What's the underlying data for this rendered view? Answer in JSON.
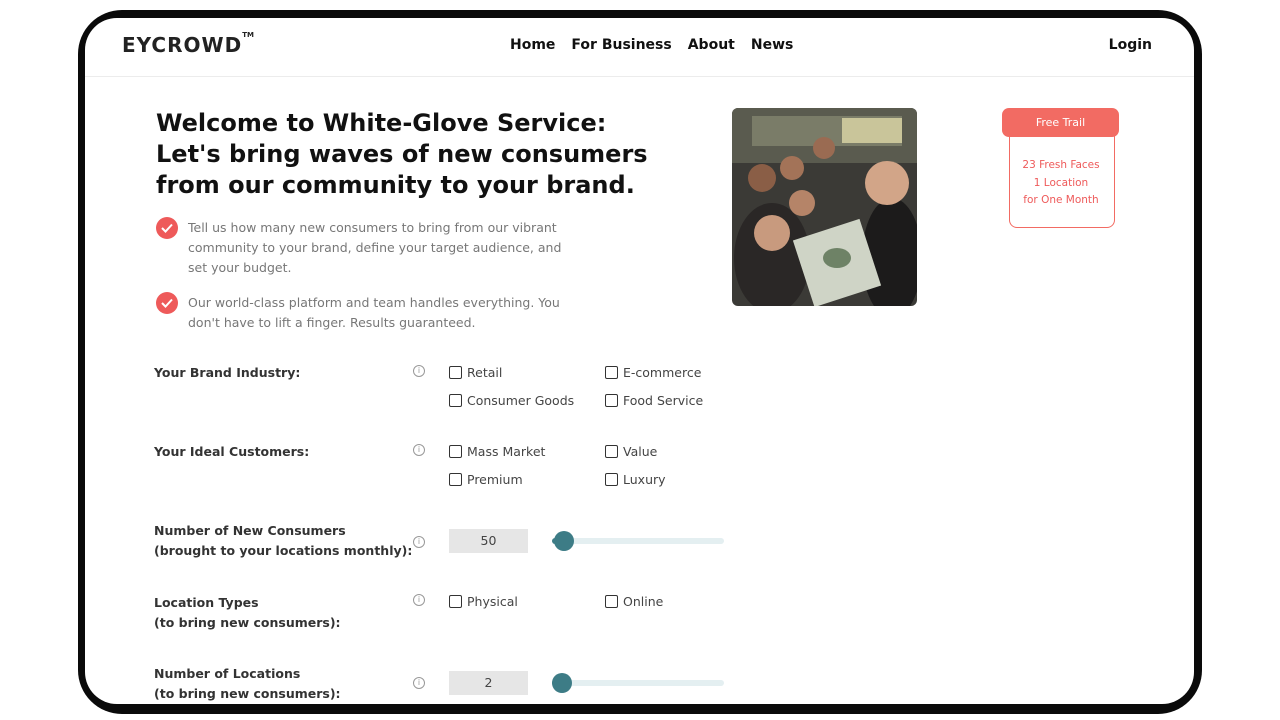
{
  "brand": {
    "logo": "EYCROWD",
    "tm": "TM"
  },
  "nav": [
    "Home",
    "For Business",
    "About",
    "News"
  ],
  "login": "Login",
  "hero": {
    "title": "Welcome to White-Glove Service: Let's bring waves of new consumers from our community to your brand.",
    "bullets": [
      "Tell us how many new consumers to bring from our vibrant community to your brand, define your target audience, and set your budget.",
      "Our world-class platform and team handles everything. You don't have to lift a finger. Results guaranteed."
    ]
  },
  "promo": {
    "button": "Free Trail",
    "lines": [
      "23 Fresh Faces",
      "1 Location",
      "for One Month"
    ],
    "accent": "#f26b63"
  },
  "form": {
    "industry": {
      "label": "Your Brand Industry:",
      "options": [
        "Retail",
        "E-commerce",
        "Consumer Goods",
        "Food Service"
      ]
    },
    "customers": {
      "label": "Your Ideal Customers:",
      "options": [
        "Mass Market",
        "Value",
        "Premium",
        "Luxury"
      ]
    },
    "consumers": {
      "label_1": "Number of New Consumers",
      "label_2": "(brought to your locations monthly):",
      "value": "50",
      "slider_level": 0.07
    },
    "location_types": {
      "label_1": "Location Types",
      "label_2": "(to bring new consumers):",
      "options": [
        "Physical",
        "Online"
      ]
    },
    "locations": {
      "label_1": "Number of Locations",
      "label_2": "(to bring new consumers):",
      "value": "2",
      "slider_level": 0.06
    }
  },
  "colors": {
    "check": "#ee5a5a",
    "slider": "#3d7c86",
    "track": "#e4eff1"
  },
  "icons": {
    "bullet": "check-circle-icon",
    "info": "info-icon"
  }
}
